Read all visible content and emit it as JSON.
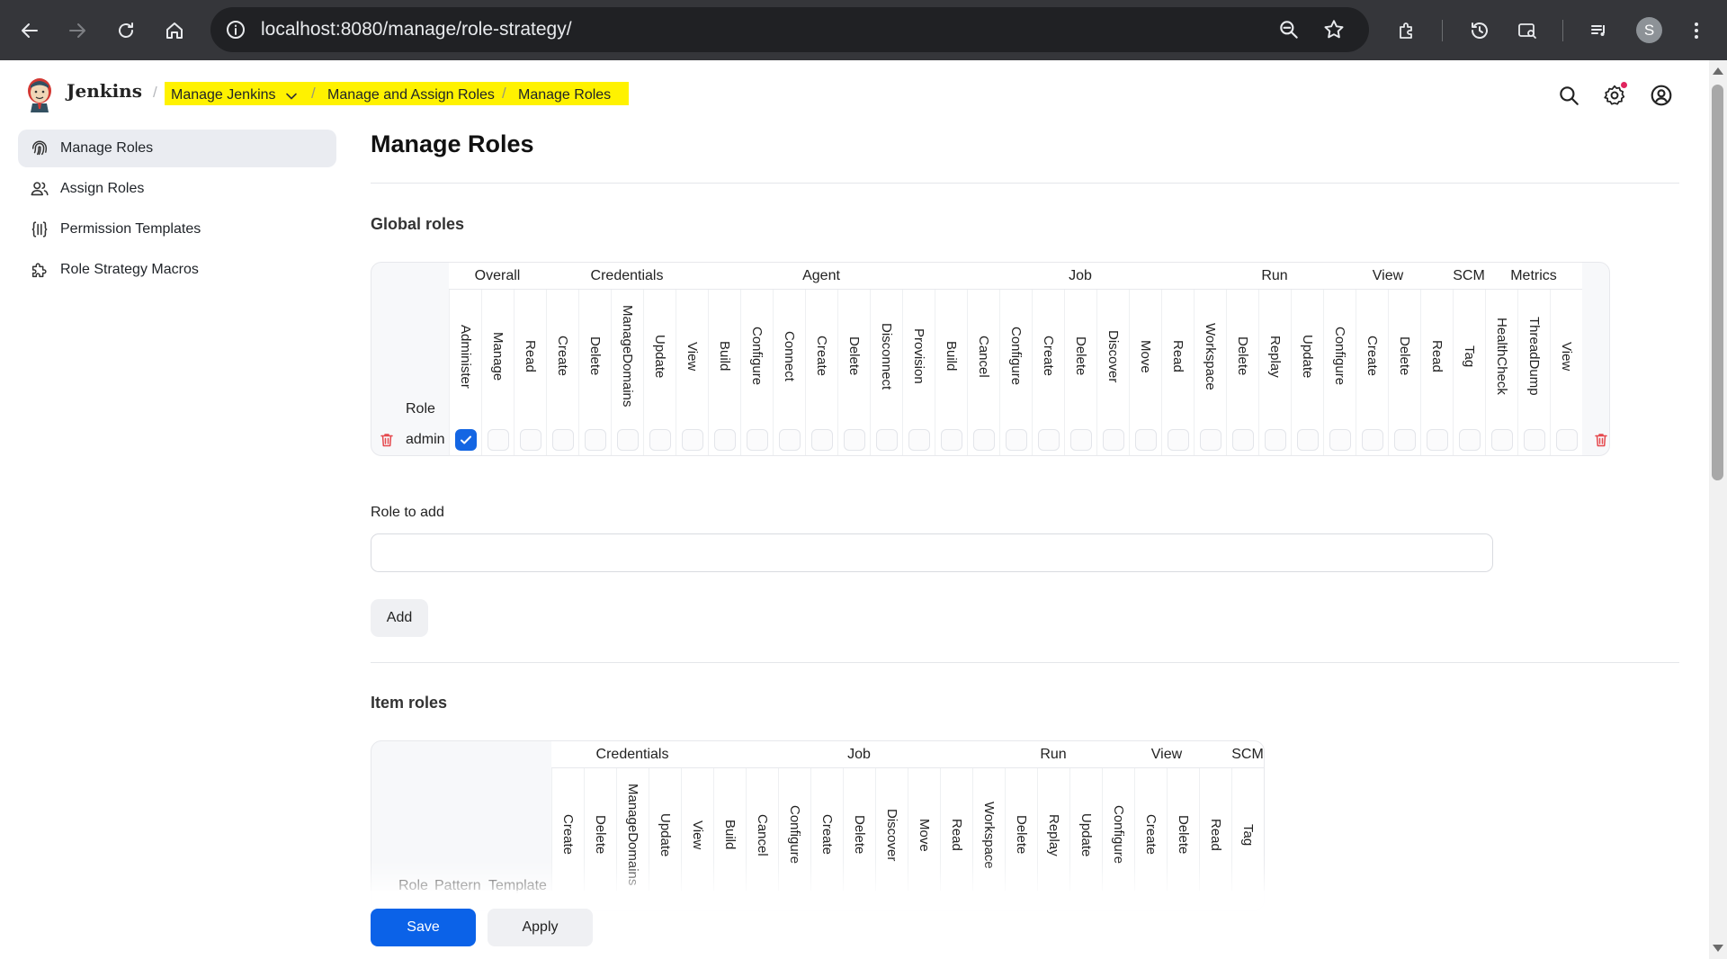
{
  "browser": {
    "url": "localhost:8080/manage/role-strategy/",
    "profile_initial": "S"
  },
  "header": {
    "brand": "Jenkins",
    "breadcrumbs": [
      "Manage Jenkins",
      "Manage and Assign Roles",
      "Manage Roles"
    ]
  },
  "sidebar": {
    "items": [
      {
        "label": "Manage Roles",
        "icon": "fingerprint-icon",
        "active": true
      },
      {
        "label": "Assign Roles",
        "icon": "users-icon",
        "active": false
      },
      {
        "label": "Permission Templates",
        "icon": "braces-icon",
        "active": false
      },
      {
        "label": "Role Strategy Macros",
        "icon": "puzzle-icon",
        "active": false
      }
    ]
  },
  "main": {
    "title": "Manage Roles",
    "global_roles": {
      "title": "Global roles",
      "role_header": "Role",
      "groups": [
        {
          "name": "Overall",
          "permissions": [
            "Administer",
            "Manage",
            "Read"
          ]
        },
        {
          "name": "Credentials",
          "permissions": [
            "Create",
            "Delete",
            "ManageDomains",
            "Update",
            "View"
          ]
        },
        {
          "name": "Agent",
          "permissions": [
            "Build",
            "Configure",
            "Connect",
            "Create",
            "Delete",
            "Disconnect",
            "Provision"
          ]
        },
        {
          "name": "Job",
          "permissions": [
            "Build",
            "Cancel",
            "Configure",
            "Create",
            "Delete",
            "Discover",
            "Move",
            "Read",
            "Workspace"
          ]
        },
        {
          "name": "Run",
          "permissions": [
            "Delete",
            "Replay",
            "Update"
          ]
        },
        {
          "name": "View",
          "permissions": [
            "Configure",
            "Create",
            "Delete",
            "Read"
          ]
        },
        {
          "name": "SCM",
          "permissions": [
            "Tag"
          ]
        },
        {
          "name": "Metrics",
          "permissions": [
            "HealthCheck",
            "ThreadDump",
            "View"
          ]
        }
      ],
      "rows": [
        {
          "role": "admin",
          "checked": [
            "Overall/Administer"
          ]
        }
      ]
    },
    "role_to_add": {
      "label": "Role to add",
      "value": "",
      "placeholder": ""
    },
    "add_label": "Add",
    "item_roles": {
      "title": "Item roles",
      "headers": [
        "Role",
        "Pattern",
        "Template"
      ],
      "groups": [
        {
          "name": "Credentials",
          "permissions": [
            "Create",
            "Delete",
            "ManageDomains",
            "Update",
            "View"
          ]
        },
        {
          "name": "Job",
          "permissions": [
            "Build",
            "Cancel",
            "Configure",
            "Create",
            "Delete",
            "Discover",
            "Move",
            "Read",
            "Workspace"
          ]
        },
        {
          "name": "Run",
          "permissions": [
            "Delete",
            "Replay",
            "Update"
          ]
        },
        {
          "name": "View",
          "permissions": [
            "Configure",
            "Create",
            "Delete",
            "Read"
          ]
        },
        {
          "name": "SCM",
          "permissions": [
            "Tag"
          ]
        }
      ]
    }
  },
  "footer": {
    "save_label": "Save",
    "apply_label": "Apply"
  },
  "colors": {
    "accent": "#0b62e8",
    "checkbox_checked": "#1466e3",
    "delete_icon": "#e5484d",
    "breadcrumb_highlight": "#fff200"
  }
}
